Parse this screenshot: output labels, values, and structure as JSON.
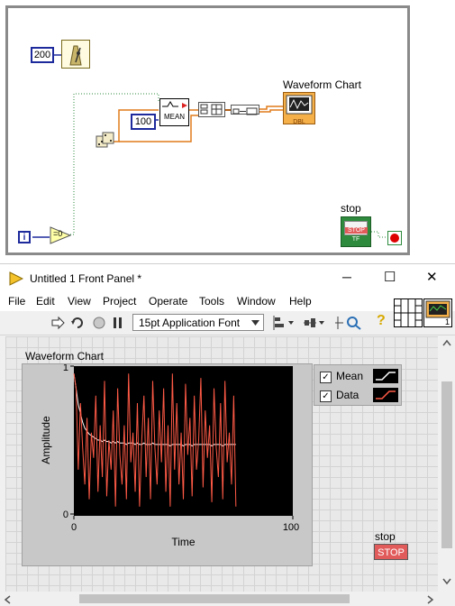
{
  "block_diagram": {
    "wait_constant": "200",
    "mean_samples_constant": "100",
    "mean_label": "MEAN",
    "chart_terminal_label": "Waveform Chart",
    "chart_terminal_type": "DBL",
    "stop_terminal_label": "stop",
    "stop_terminal_text": "STOP",
    "stop_terminal_type": "TF",
    "iteration_label": "i",
    "compare_label": "=0"
  },
  "window": {
    "title": "Untitled 1 Front Panel *",
    "minimize_glyph": "─",
    "maximize_glyph": "☐",
    "close_glyph": "✕"
  },
  "menu": [
    "File",
    "Edit",
    "View",
    "Project",
    "Operate",
    "Tools",
    "Window",
    "Help"
  ],
  "toolbar": {
    "font_select": "15pt Application Font",
    "help_glyph": "?",
    "connector_pane_number": "1"
  },
  "panel": {
    "chart_title": "Waveform Chart",
    "legend": [
      {
        "label": "Mean",
        "checked": true,
        "color": "#ffffff"
      },
      {
        "label": "Data",
        "checked": true,
        "color": "#ff5a46"
      }
    ],
    "stop_label": "stop",
    "stop_button_text": "STOP"
  },
  "chart_data": {
    "type": "line",
    "xlabel": "Time",
    "ylabel": "Amplitude",
    "xlim": [
      0,
      100
    ],
    "ylim": [
      0,
      1
    ],
    "x_ticks": [
      "0",
      "100"
    ],
    "y_ticks": [
      "1",
      "0"
    ],
    "series": [
      {
        "name": "Data",
        "color": "#ff5a46",
        "values": [
          0.95,
          0.85,
          0.3,
          0.75,
          0.45,
          0.2,
          0.65,
          0.1,
          0.55,
          0.38,
          0.8,
          0.15,
          0.6,
          0.25,
          0.9,
          0.12,
          0.5,
          0.3,
          0.7,
          0.05,
          0.85,
          0.4,
          0.2,
          0.6,
          0.1,
          0.95,
          0.35,
          0.55,
          0.15,
          0.75,
          0.05,
          0.5,
          0.8,
          0.25,
          0.65,
          0.1,
          0.9,
          0.45,
          0.2,
          0.7,
          0.35,
          0.85,
          0.15,
          0.6,
          0.05,
          0.95,
          0.3,
          0.75,
          0.2,
          0.55,
          0.1,
          0.88,
          0.4,
          0.65,
          0.12,
          0.8,
          0.3,
          0.5,
          0.92,
          0.18,
          0.7,
          0.38,
          0.6,
          0.08,
          0.85,
          0.45,
          0.25,
          0.75,
          0.1,
          0.9,
          0.35,
          0.55,
          0.2,
          0.8,
          0.05
        ]
      },
      {
        "name": "Mean",
        "color": "#ffffff",
        "values": [
          0.95,
          0.85,
          0.74,
          0.68,
          0.62,
          0.58,
          0.56,
          0.54,
          0.53,
          0.52,
          0.51,
          0.5,
          0.5,
          0.49,
          0.5,
          0.49,
          0.49,
          0.48,
          0.49,
          0.48,
          0.49,
          0.48,
          0.48,
          0.48,
          0.47,
          0.48,
          0.48,
          0.48,
          0.47,
          0.48,
          0.47,
          0.47,
          0.48,
          0.47,
          0.47,
          0.47,
          0.48,
          0.47,
          0.47,
          0.47,
          0.47,
          0.47,
          0.47,
          0.47,
          0.46,
          0.47,
          0.47,
          0.47,
          0.47,
          0.47,
          0.46,
          0.47,
          0.47,
          0.47,
          0.46,
          0.47,
          0.47,
          0.47,
          0.47,
          0.47,
          0.47,
          0.47,
          0.47,
          0.46,
          0.47,
          0.47,
          0.47,
          0.47,
          0.46,
          0.47,
          0.47,
          0.47,
          0.47,
          0.47,
          0.47
        ]
      }
    ]
  }
}
